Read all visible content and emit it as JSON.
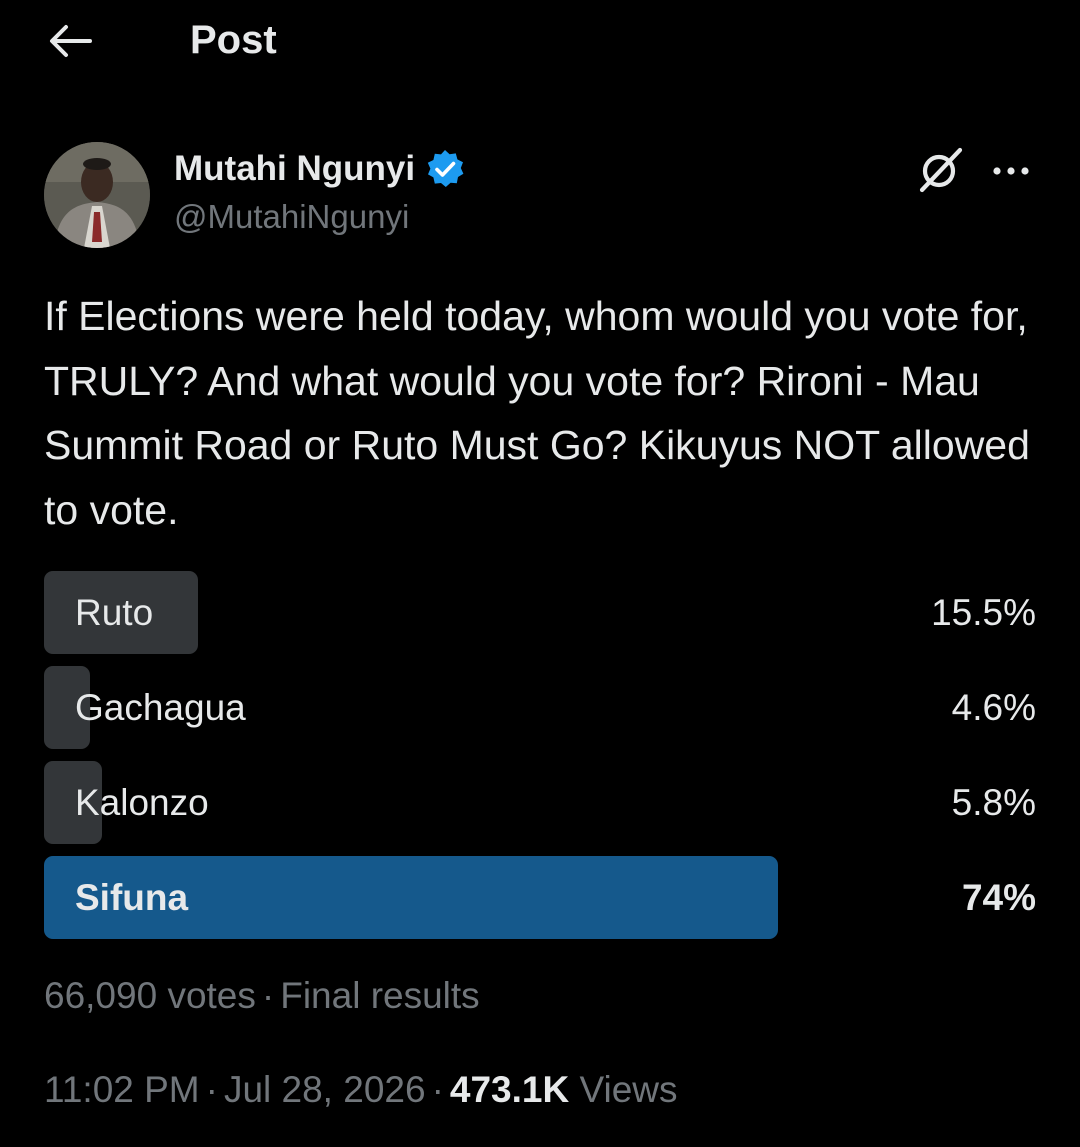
{
  "header": {
    "title": "Post",
    "back_icon": "arrow-left-icon"
  },
  "author": {
    "display_name": "Mutahi Ngunyi",
    "handle": "@MutahiNgunyi",
    "verified": true,
    "verified_color": "#1d9bf0"
  },
  "post": {
    "text": "If Elections were held today, whom would you vote for, TRULY? And what would you vote for? Rironi - Mau Summit Road or Ruto Must Go? Kikuyus NOT allowed to vote."
  },
  "poll": {
    "options": [
      {
        "label": "Ruto",
        "percent_text": "15.5%",
        "percent": 15.5,
        "winner": false
      },
      {
        "label": "Gachagua",
        "percent_text": "4.6%",
        "percent": 4.6,
        "winner": false
      },
      {
        "label": "Kalonzo",
        "percent_text": "5.8%",
        "percent": 5.8,
        "winner": false
      },
      {
        "label": "Sifuna",
        "percent_text": "74%",
        "percent": 74,
        "winner": true
      }
    ],
    "votes": "66,090 votes",
    "separator": "·",
    "status": "Final results",
    "winner_color": "#15598c",
    "bar_color": "#333639"
  },
  "meta": {
    "time": "11:02 PM",
    "separator": "·",
    "date": "Jul 28, 2026",
    "views_count": "473.1K",
    "views_label": "Views"
  }
}
